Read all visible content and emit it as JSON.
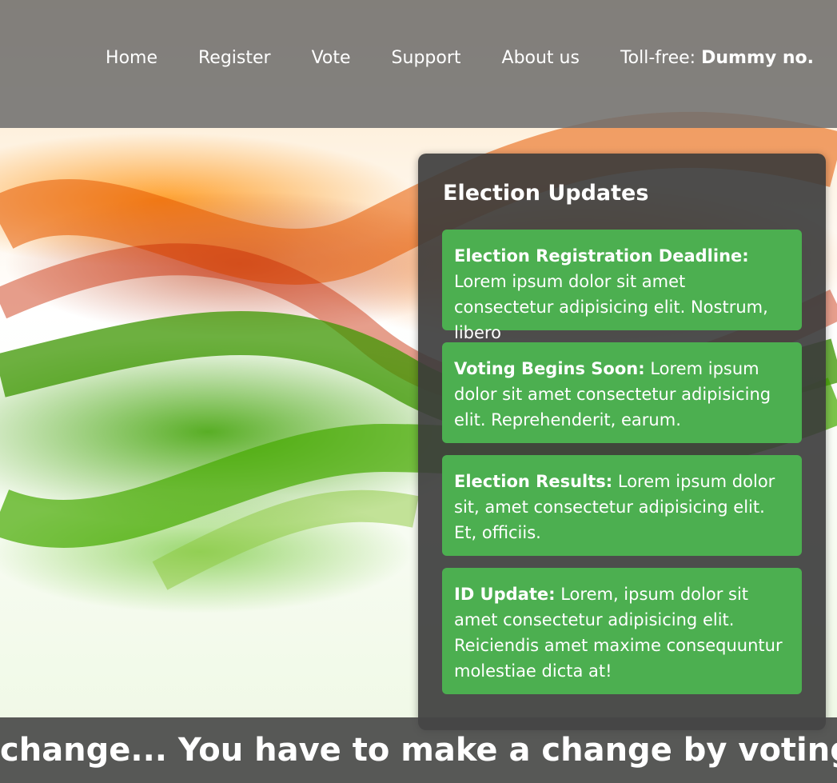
{
  "nav": {
    "items": [
      {
        "label": "Home"
      },
      {
        "label": "Register"
      },
      {
        "label": "Vote"
      },
      {
        "label": "Support"
      },
      {
        "label": "About us"
      }
    ],
    "tollfree_label": "Toll-free:",
    "tollfree_number": "Dummy no."
  },
  "updates": {
    "title": "Election Updates",
    "items": [
      {
        "heading": "Election Registration Deadline:",
        "text": "Lorem ipsum dolor sit amet consectetur adipisicing elit. Nostrum, libero"
      },
      {
        "heading": "Voting Begins Soon:",
        "text": "Lorem ipsum dolor sit amet consectetur adipisicing elit. Reprehenderit, earum."
      },
      {
        "heading": "Election Results:",
        "text": "Lorem ipsum dolor sit, amet consectetur adipisicing elit. Et, officiis."
      },
      {
        "heading": "ID Update:",
        "text": "Lorem, ipsum dolor sit amet consectetur adipisicing elit. Reiciendis amet maxime consequuntur molestiae dicta at!"
      }
    ]
  },
  "footer": {
    "ticker": "change... You have to make a change by voting."
  },
  "colors": {
    "update_card": "#4caf50",
    "panel_bg": "#3a3a3a",
    "header_bg": "#6e6e6e"
  }
}
